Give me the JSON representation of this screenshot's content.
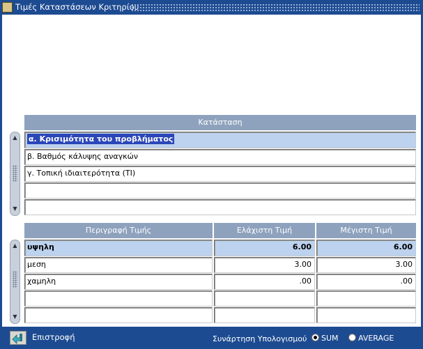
{
  "window": {
    "title": "Τιμές Καταστάσεων Κριτηρίου"
  },
  "states": {
    "header": "Κατάσταση",
    "rows": [
      "α. Κρισιμότητα του προβλήματος",
      "β. Βαθμός κάλυψης αναγκών",
      "γ. Τοπική ιδιαιτερότητα (ΤΙ)",
      "",
      ""
    ]
  },
  "values": {
    "headers": [
      "Περιγραφή Τιμής",
      "Ελάχιστη Τιμή",
      "Μέγιστη Τιμή"
    ],
    "rows": [
      {
        "desc": "υψηλη",
        "min": "6.00",
        "max": "6.00"
      },
      {
        "desc": "μεση",
        "min": "3.00",
        "max": "3.00"
      },
      {
        "desc": "χαμηλη",
        "min": ".00",
        "max": ".00"
      },
      {
        "desc": "",
        "min": "",
        "max": ""
      },
      {
        "desc": "",
        "min": "",
        "max": ""
      }
    ]
  },
  "footer": {
    "back_label": "Επιστροφή",
    "function_label": "Συνάρτηση Υπολογισμού",
    "options": [
      "SUM",
      "AVERAGE"
    ],
    "selected": "SUM"
  },
  "colors": {
    "titlebar": "#1d4b91",
    "header": "#8ea2bd",
    "selected_row": "#bcd2ee",
    "text_highlight": "#2a46b8"
  }
}
